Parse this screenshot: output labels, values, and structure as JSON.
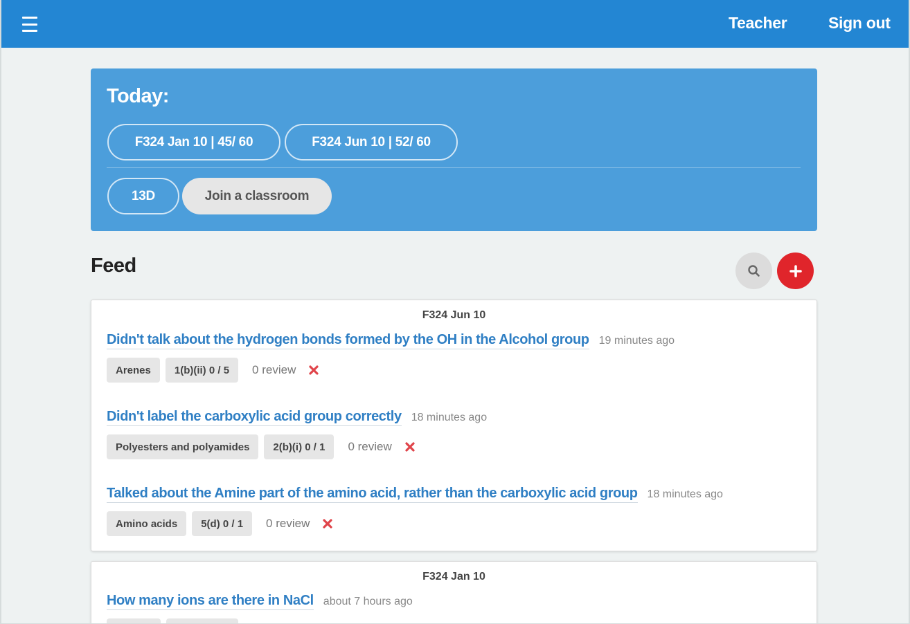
{
  "nav": {
    "teacher_label": "Teacher",
    "signout_label": "Sign out"
  },
  "today": {
    "title": "Today:",
    "papers": [
      {
        "label": "F324 Jan 10 | 45/ 60"
      },
      {
        "label": "F324 Jun 10 | 52/ 60"
      }
    ],
    "classroom": {
      "label": "13D"
    },
    "join_label": "Join a classroom"
  },
  "feed": {
    "title": "Feed",
    "cards": [
      {
        "header": "F324 Jun 10",
        "entries": [
          {
            "title": "Didn't talk about the hydrogen bonds formed by the OH in the Alcohol group",
            "time": "19 minutes ago",
            "topic": "Arenes",
            "question": "1(b)(ii) 0 / 5",
            "review": "0 review"
          },
          {
            "title": "Didn't label the carboxylic acid group correctly",
            "time": "18 minutes ago",
            "topic": "Polyesters and polyamides",
            "question": "2(b)(i) 0 / 1",
            "review": "0 review"
          },
          {
            "title": "Talked about the Amine part of the amino acid, rather than the carboxylic acid group",
            "time": "18 minutes ago",
            "topic": "Amino acids",
            "question": "5(d) 0 / 1",
            "review": "0 review"
          }
        ]
      },
      {
        "header": "F324 Jan 10",
        "entries": [
          {
            "title": "How many ions are there in NaCl",
            "time": "about 7 hours ago"
          }
        ]
      }
    ]
  },
  "icons": {
    "menu": "hamburger-icon",
    "search": "search-icon",
    "add": "plus-icon",
    "remove": "close-icon"
  },
  "colors": {
    "navbar": "#2386d3",
    "today_panel": "#4c9edb",
    "link": "#2f7fc4",
    "add_button": "#e0252b",
    "remove_icon": "#e0444a"
  }
}
